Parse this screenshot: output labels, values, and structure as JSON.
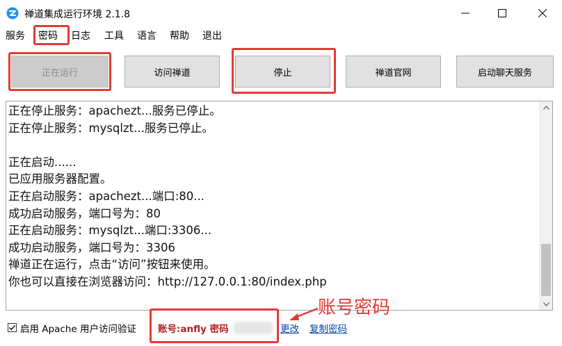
{
  "window": {
    "title": "禅道集成运行环境 2.1.8",
    "controls": [
      "minimize",
      "maximize",
      "close"
    ]
  },
  "menu": {
    "items": [
      "服务",
      "密码",
      "日志",
      "工具",
      "语言",
      "帮助",
      "退出"
    ]
  },
  "buttons": {
    "running": "正在运行",
    "visit": "访问禅道",
    "stop": "停止",
    "official": "禅道官网",
    "chat": "启动聊天服务"
  },
  "log": {
    "lines": [
      "正在停止服务：apachezt...服务已停止。",
      "正在停止服务：mysqlzt...服务已停止。",
      "",
      "正在启动......",
      "已应用服务器配置。",
      "正在启动服务：apachezt...端口:80...",
      "成功启动服务，端口号为：80",
      "正在启动服务：mysqlzt...端口:3306...",
      "成功启动服务，端口号为：3306",
      "禅道正在运行，点击“访问”按钮来使用。",
      "你也可以直接在浏览器访问：http://127.0.0.1:80/index.php"
    ]
  },
  "bottom": {
    "checkbox_label": "启用 Apache 用户访问验证",
    "checkbox_checked": true,
    "account_label": "账号:anfly 密码",
    "change_link": "更改",
    "copy_link": "复制密码"
  },
  "annotation": {
    "text": "账号密码",
    "color": "#e53935"
  }
}
